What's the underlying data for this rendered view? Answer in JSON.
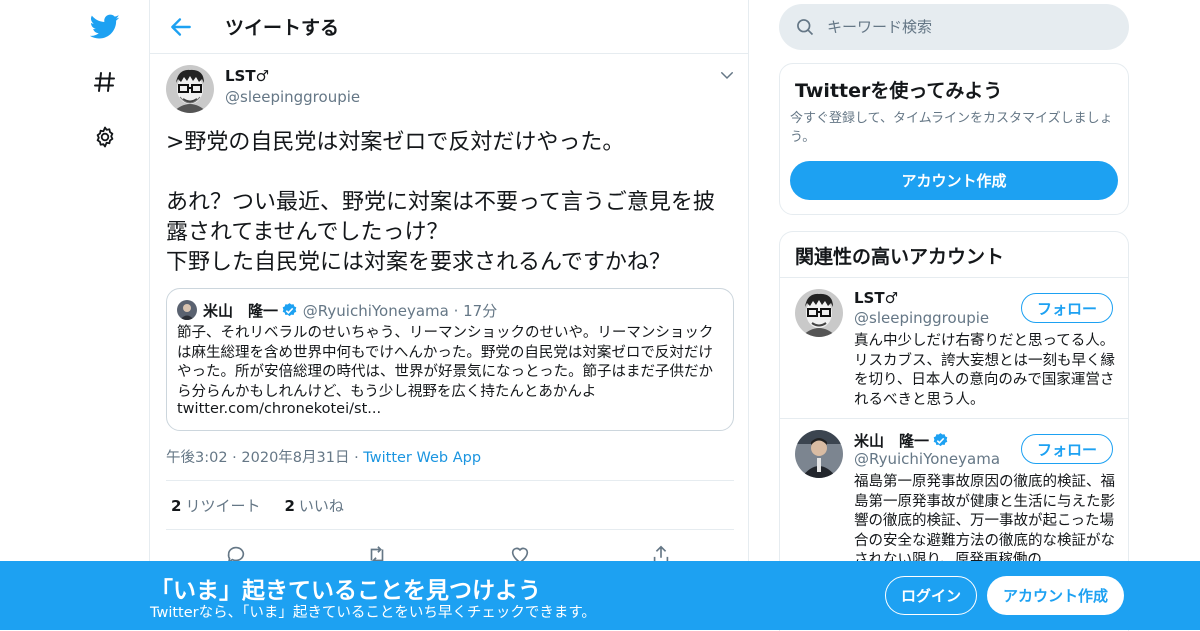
{
  "header": {
    "title": "ツイートする"
  },
  "tweet": {
    "author_name": "LST♂",
    "author_handle": "@sleepinggroupie",
    "text": ">野党の自民党は対案ゼロで反対だけやった。\n\nあれ？つい最近、野党に対案は不要って言うご意見を披露されてませんでしたっけ？\n下野した自民党には対案を要求されるんですかね？",
    "quote": {
      "name": "米山　隆一",
      "handle": "@RyuichiYoneyama",
      "time": "17分",
      "text": "節子、それリベラルのせいちゃう、リーマンショックのせいや。リーマンショックは麻生総理を含め世界中何もでけへんかった。野党の自民党は対案ゼロで反対だけやった。所が安倍総理の時代は、世界が好景気になっとった。節子はまだ子供だから分らんかもしれんけど、もう少し視野を広く持たんとあかんよ",
      "link": "twitter.com/chronekotei/st..."
    },
    "time": "午後3:02",
    "date": "2020年8月31日",
    "client": "Twitter Web App",
    "retweets": "2",
    "retweets_label": "リツイート",
    "likes": "2",
    "likes_label": "いいね"
  },
  "search": {
    "placeholder": "キーワード検索"
  },
  "signup_card": {
    "title": "Twitterを使ってみよう",
    "text": "今すぐ登録して、タイムラインをカスタマイズしましょう。",
    "button": "アカウント作成"
  },
  "related": {
    "title": "関連性の高いアカウント",
    "accounts": [
      {
        "name": "LST♂",
        "handle": "@sleepinggroupie",
        "follow": "フォロー",
        "bio": "真ん中少しだけ右寄りだと思ってる人。リスカブス、誇大妄想とは一刻も早く縁を切り、日本人の意向のみで国家運営されるべきと思う人。"
      },
      {
        "name": "米山　隆一",
        "handle": "@RyuichiYoneyama",
        "follow": "フォロー",
        "bio": "福島第一原発事故原因の徹底的検証、福島第一原発事故が健康と生活に与えた影響の徹底的検証、万一事故が起こった場合の安全な避難方法の徹底的な検証がなされない限り、原発再稼働の"
      }
    ]
  },
  "banner": {
    "title": "「いま」起きていることを見つけよう",
    "subtitle": "Twitterなら、「いま」起きていることをいち早くチェックできます。",
    "login": "ログイン",
    "signup": "アカウント作成"
  },
  "colors": {
    "accent": "#1da1f2",
    "secondary_text": "#657786",
    "border": "#e6ecf0"
  }
}
